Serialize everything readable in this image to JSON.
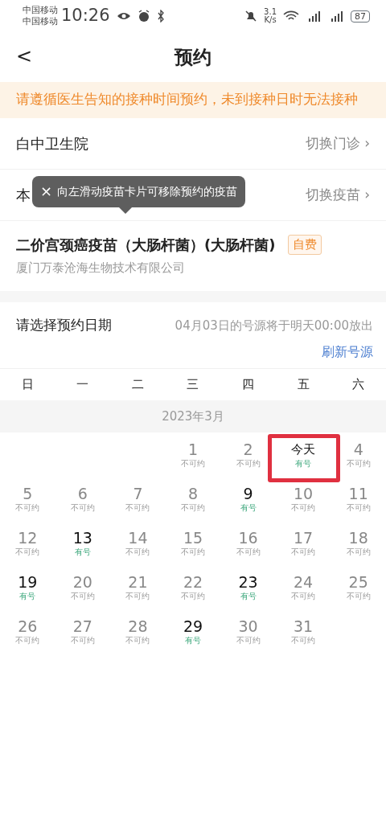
{
  "status_bar": {
    "carriers": [
      "中国移动",
      "中国移动"
    ],
    "time": "10:26",
    "net_speed": [
      "3.1",
      "K/s"
    ],
    "battery": "87"
  },
  "header": {
    "back": "<",
    "title": "预约"
  },
  "notice": "请遵循医生告知的接种时间预约，未到接种日时无法接种",
  "rows": [
    {
      "label": "白中卫生院",
      "action": "切换门诊",
      "chevron": "›"
    },
    {
      "label": "本",
      "action": "切换疫苗",
      "chevron": "›"
    }
  ],
  "tooltip": {
    "close": "×",
    "text": "向左滑动疫苗卡片可移除预约的疫苗"
  },
  "vaccine": {
    "name": "二价宫颈癌疫苗（大肠杆菌）(大肠杆菌)",
    "tag": "自费",
    "maker": "厦门万泰沧海生物技术有限公司"
  },
  "date_section": {
    "title": "请选择预约日期",
    "hint": "04月03日的号源将于明天00:00放出",
    "refresh": "刷新号源"
  },
  "weekdays": [
    "日",
    "一",
    "二",
    "三",
    "四",
    "五",
    "六"
  ],
  "month": "2023年3月",
  "days": [
    {
      "day": "1",
      "status": "不可约",
      "available": false,
      "today": false
    },
    {
      "day": "2",
      "status": "不可约",
      "available": false,
      "today": false
    },
    {
      "day": "今天",
      "status": "有号",
      "available": true,
      "today": true,
      "highlighted": true
    },
    {
      "day": "4",
      "status": "不可约",
      "available": false,
      "today": false
    },
    {
      "day": "5",
      "status": "不可约",
      "available": false,
      "today": false
    },
    {
      "day": "6",
      "status": "不可约",
      "available": false,
      "today": false
    },
    {
      "day": "7",
      "status": "不可约",
      "available": false,
      "today": false
    },
    {
      "day": "8",
      "status": "不可约",
      "available": false,
      "today": false
    },
    {
      "day": "9",
      "status": "有号",
      "available": true,
      "today": false
    },
    {
      "day": "10",
      "status": "不可约",
      "available": false,
      "today": false
    },
    {
      "day": "11",
      "status": "不可约",
      "available": false,
      "today": false
    },
    {
      "day": "12",
      "status": "不可约",
      "available": false,
      "today": false
    },
    {
      "day": "13",
      "status": "有号",
      "available": true,
      "today": false
    },
    {
      "day": "14",
      "status": "不可约",
      "available": false,
      "today": false
    },
    {
      "day": "15",
      "status": "不可约",
      "available": false,
      "today": false
    },
    {
      "day": "16",
      "status": "不可约",
      "available": false,
      "today": false
    },
    {
      "day": "17",
      "status": "不可约",
      "available": false,
      "today": false
    },
    {
      "day": "18",
      "status": "不可约",
      "available": false,
      "today": false
    },
    {
      "day": "19",
      "status": "有号",
      "available": true,
      "today": false
    },
    {
      "day": "20",
      "status": "不可约",
      "available": false,
      "today": false
    },
    {
      "day": "21",
      "status": "不可约",
      "available": false,
      "today": false
    },
    {
      "day": "22",
      "status": "不可约",
      "available": false,
      "today": false
    },
    {
      "day": "23",
      "status": "有号",
      "available": true,
      "today": false
    },
    {
      "day": "24",
      "status": "不可约",
      "available": false,
      "today": false
    },
    {
      "day": "25",
      "status": "不可约",
      "available": false,
      "today": false
    },
    {
      "day": "26",
      "status": "不可约",
      "available": false,
      "today": false
    },
    {
      "day": "27",
      "status": "不可约",
      "available": false,
      "today": false
    },
    {
      "day": "28",
      "status": "不可约",
      "available": false,
      "today": false
    },
    {
      "day": "29",
      "status": "有号",
      "available": true,
      "today": false
    },
    {
      "day": "30",
      "status": "不可约",
      "available": false,
      "today": false
    },
    {
      "day": "31",
      "status": "不可约",
      "available": false,
      "today": false
    }
  ]
}
